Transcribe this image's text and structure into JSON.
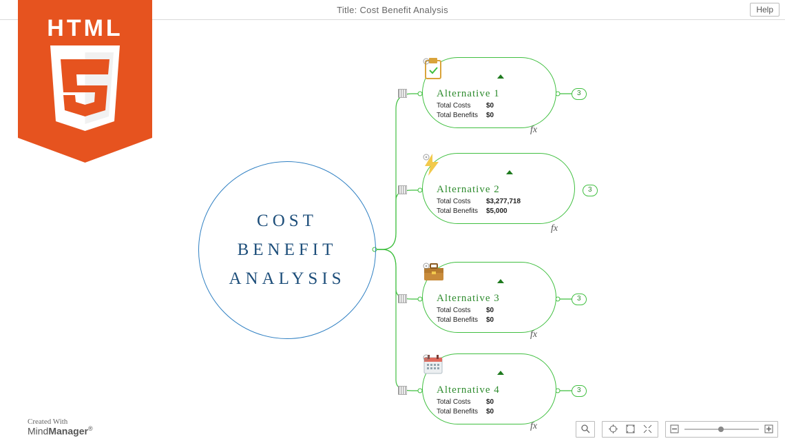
{
  "header": {
    "title": "Title: Cost Benefit Analysis",
    "help_label": "Help"
  },
  "badge": {
    "text": "HTML"
  },
  "central": {
    "title_line1": "COST",
    "title_line2": "BENEFIT",
    "title_line3": "ANALYSIS"
  },
  "nodes": [
    {
      "title": "Alternative 1",
      "icon": "clipboard-check",
      "rows": [
        {
          "label": "Total Costs",
          "value": "$0"
        },
        {
          "label": "Total Benefits",
          "value": "$0"
        }
      ],
      "child_count": "3",
      "fx": "fx"
    },
    {
      "title": "Alternative 2",
      "icon": "lightning-bolt",
      "rows": [
        {
          "label": "Total Costs",
          "value": "$3,277,718"
        },
        {
          "label": "Total Benefits",
          "value": "$5,000"
        }
      ],
      "child_count": "3",
      "fx": "fx"
    },
    {
      "title": "Alternative 3",
      "icon": "briefcase",
      "rows": [
        {
          "label": "Total Costs",
          "value": "$0"
        },
        {
          "label": "Total Benefits",
          "value": "$0"
        }
      ],
      "child_count": "3",
      "fx": "fx"
    },
    {
      "title": "Alternative 4",
      "icon": "calendar",
      "rows": [
        {
          "label": "Total Costs",
          "value": "$0"
        },
        {
          "label": "Total Benefits",
          "value": "$0"
        }
      ],
      "child_count": "3",
      "fx": "fx"
    }
  ],
  "footer": {
    "credits_line1": "Created With",
    "credits_brand_light": "Mind",
    "credits_brand_bold": "Manager",
    "credits_reg": "®"
  }
}
